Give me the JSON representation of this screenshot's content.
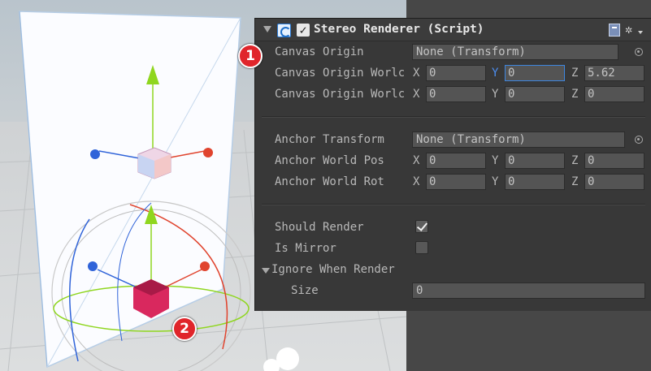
{
  "component": {
    "title": "Stereo Renderer (Script)",
    "enabled": true,
    "icons": [
      "fold-arrow-icon",
      "script-icon",
      "help-book-icon",
      "gear-icon"
    ]
  },
  "fields": {
    "canvas_origin": {
      "label": "Canvas Origin",
      "value": "None (Transform)"
    },
    "canvas_origin_world_pos": {
      "label": "Canvas Origin Worlc",
      "x": "0",
      "y": "0",
      "z": "5.62"
    },
    "canvas_origin_world_rot": {
      "label": "Canvas Origin Worlc",
      "x": "0",
      "y": "0",
      "z": "0"
    },
    "anchor_transform": {
      "label": "Anchor Transform",
      "value": "None (Transform)"
    },
    "anchor_world_pos": {
      "label": "Anchor World Pos",
      "x": "0",
      "y": "0",
      "z": "0"
    },
    "anchor_world_rot": {
      "label": "Anchor World Rot",
      "x": "0",
      "y": "0",
      "z": "0"
    },
    "should_render": {
      "label": "Should Render",
      "checked": true
    },
    "is_mirror": {
      "label": "Is Mirror",
      "checked": false
    },
    "ignore_when_render": {
      "label": "Ignore When Render"
    },
    "size": {
      "label": "Size",
      "value": "0"
    }
  },
  "axes": {
    "x": "X",
    "y": "Y",
    "z": "Z"
  },
  "badges": {
    "one": "1",
    "two": "2"
  },
  "colors": {
    "gizmo_x": "#e0442e",
    "gizmo_y": "#8fd61f",
    "gizmo_z": "#2f63d9",
    "selection_cube": "#d9285e",
    "badge": "#e0252b",
    "focus": "#3d86e0"
  }
}
